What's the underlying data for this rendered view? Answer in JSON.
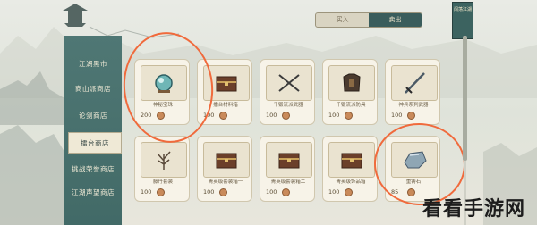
{
  "top_tabs": [
    "买入",
    "卖出"
  ],
  "banner_text": "闯荡江湖",
  "side_menu": [
    "江湖黑市",
    "商山派商店",
    "论剑商店",
    "擂台商店",
    "挑战荣誉商店",
    "江湖声望商店"
  ],
  "active_menu_index": 3,
  "items": [
    {
      "name": "神秘宝珠",
      "price": "200",
      "icon": "orb-icon"
    },
    {
      "name": "擂台材料箱",
      "price": "100",
      "icon": "chest-icon"
    },
    {
      "name": "千锻流派武器",
      "price": "100",
      "icon": "crossed-swords-icon"
    },
    {
      "name": "千锻流派防具",
      "price": "100",
      "icon": "armor-icon"
    },
    {
      "name": "神兵系列武器",
      "price": "100",
      "icon": "sword-icon"
    },
    {
      "name": "藤丹套装",
      "price": "100",
      "icon": "herb-icon"
    },
    {
      "name": "菁英级套装箱一",
      "price": "100",
      "icon": "chest-icon"
    },
    {
      "name": "菁英级套装箱二",
      "price": "100",
      "icon": "chest-icon"
    },
    {
      "name": "菁英级饰品箱",
      "price": "100",
      "icon": "chest-icon"
    },
    {
      "name": "重铸石",
      "price": "85",
      "icon": "stone-icon"
    }
  ],
  "watermark": "看看手游网",
  "colors": {
    "accent": "#3a5d5c",
    "circle": "#f06a3c"
  }
}
